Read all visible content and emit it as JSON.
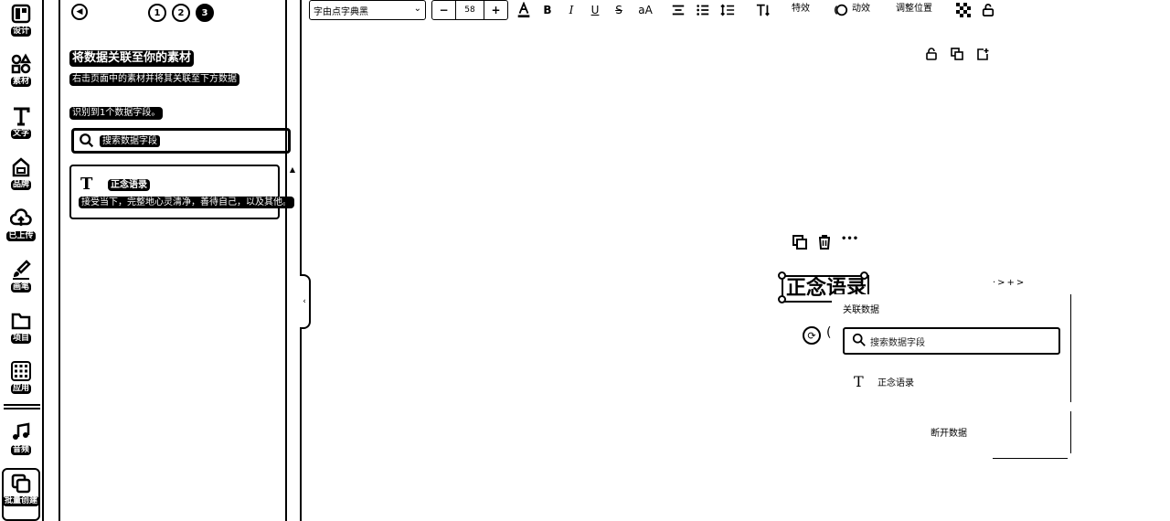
{
  "rail": {
    "items": [
      {
        "label": "设计",
        "icon": "layout-icon"
      },
      {
        "label": "素材",
        "icon": "shapes-icon"
      },
      {
        "label": "文字",
        "icon": "text-icon"
      },
      {
        "label": "品牌",
        "icon": "brand-icon"
      },
      {
        "label": "已上传",
        "icon": "cloud-upload-icon"
      },
      {
        "label": "画笔",
        "icon": "brush-icon"
      },
      {
        "label": "项目",
        "icon": "folder-icon"
      },
      {
        "label": "应用",
        "icon": "apps-grid-icon"
      },
      {
        "label": "音频",
        "icon": "music-note-icon"
      },
      {
        "label": "批量创建",
        "icon": "bulk-create-icon"
      }
    ]
  },
  "panel": {
    "steps": [
      "1",
      "2",
      "3"
    ],
    "title": "将数据关联至你的素材",
    "subtitle": "右击页面中的素材并将其关联至下方数据",
    "count_text": "识别到1个数据字段。",
    "search_placeholder": "搜索数据字段",
    "field": {
      "glyph": "T",
      "name": "正念语录",
      "value": "接受当下，完整地心灵清净，善待自己，以及其他。"
    }
  },
  "toolbar": {
    "font": "字由点字典黑",
    "font_size": "58",
    "minus": "−",
    "plus": "+",
    "effects": "特效",
    "animate": "动效",
    "position": "调整位置"
  },
  "canvas": {
    "selected_text": "正念语录",
    "faint_text": "·>+>",
    "more": "•••"
  },
  "popover": {
    "title": "关联数据",
    "search_placeholder": "搜索数据字段",
    "field_glyph": "T",
    "field_name": "正念语录",
    "disconnect": "断开数据"
  }
}
